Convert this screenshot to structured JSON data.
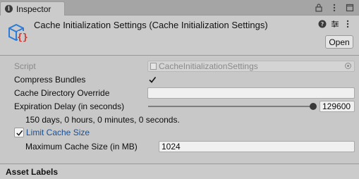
{
  "tab": {
    "label": "Inspector"
  },
  "header": {
    "title": "Cache Initialization Settings (Cache Initialization Settings)",
    "open_label": "Open"
  },
  "fields": {
    "script": {
      "label": "Script",
      "value": "CacheInitializationSettings"
    },
    "compress_bundles": {
      "label": "Compress Bundles",
      "checked": true
    },
    "cache_directory_override": {
      "label": "Cache Directory Override",
      "value": ""
    },
    "expiration_delay": {
      "label": "Expiration Delay (in seconds)",
      "value": "129600",
      "slider_fraction": 1.0,
      "summary": "150 days, 0 hours, 0 minutes, 0 seconds."
    },
    "limit_cache_size": {
      "label": "Limit Cache Size",
      "checked": true
    },
    "maximum_cache_size": {
      "label": "Maximum Cache Size (in MB)",
      "value": "1024"
    }
  },
  "footer": {
    "label": "Asset Labels"
  },
  "colors": {
    "accent_label": "#1b4f8f",
    "panel": "#c8c8c8",
    "tab_strip": "#a5a5a5"
  },
  "icons": [
    "info-icon",
    "lock-icon",
    "menu-icon",
    "maximize-icon",
    "more-icon",
    "help-icon",
    "preset-icon",
    "script-asset-icon",
    "object-picker-icon",
    "checkmark-icon"
  ]
}
